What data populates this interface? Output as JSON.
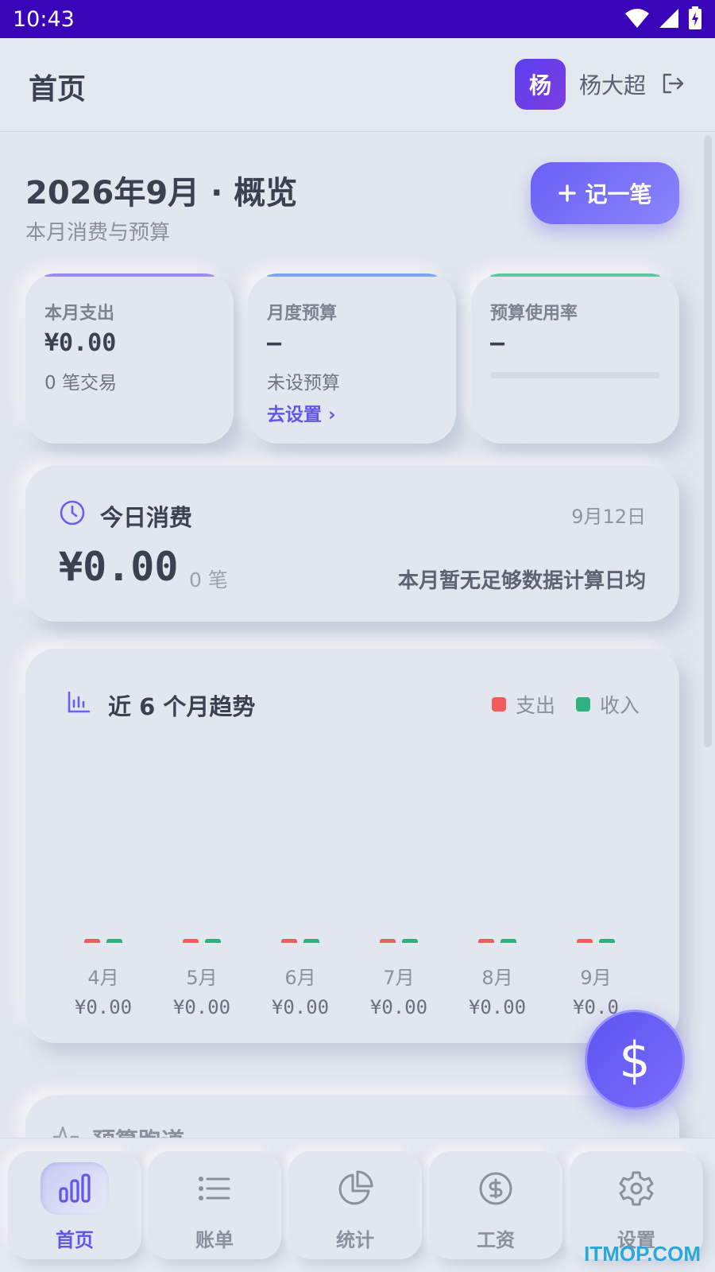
{
  "status_bar": {
    "time": "10:43"
  },
  "header": {
    "title": "首页",
    "avatar_text": "杨",
    "username": "杨大超"
  },
  "overview": {
    "title": "2026年9月 · 概览",
    "subtitle": "本月消费与预算",
    "add_button": "记一笔"
  },
  "stats": [
    {
      "label": "本月支出",
      "value": "¥0.00",
      "note": "0 笔交易",
      "accent": "#9b8cf0"
    },
    {
      "label": "月度预算",
      "value": "–",
      "note": "未设预算",
      "link": "去设置 ›",
      "accent": "#7aa6f0"
    },
    {
      "label": "预算使用率",
      "value": "–",
      "accent": "#5ccaa0",
      "progress": 0
    }
  ],
  "today": {
    "title": "今日消费",
    "date": "9月12日",
    "amount": "¥0.00",
    "count": "0 笔",
    "avg_note": "本月暂无足够数据计算日均"
  },
  "trend": {
    "title": "近 6 个月趋势",
    "legend": [
      {
        "name": "支出",
        "color": "#f25c5c"
      },
      {
        "name": "收入",
        "color": "#2fb07f"
      }
    ]
  },
  "chart_data": {
    "type": "bar",
    "categories": [
      "4月",
      "5月",
      "6月",
      "7月",
      "8月",
      "9月"
    ],
    "series": [
      {
        "name": "支出",
        "values": [
          0,
          0,
          0,
          0,
          0,
          0
        ]
      },
      {
        "name": "收入",
        "values": [
          0,
          0,
          0,
          0,
          0,
          0
        ]
      }
    ],
    "value_labels": [
      "¥0.00",
      "¥0.00",
      "¥0.00",
      "¥0.00",
      "¥0.00",
      "¥0.0"
    ],
    "title": "近 6 个月趋势"
  },
  "runway": {
    "title": "预算跑道"
  },
  "fab": {
    "symbol": "$"
  },
  "nav": [
    {
      "label": "首页",
      "icon": "bar-chart-icon",
      "active": true
    },
    {
      "label": "账单",
      "icon": "list-icon",
      "active": false
    },
    {
      "label": "统计",
      "icon": "pie-chart-icon",
      "active": false
    },
    {
      "label": "工资",
      "icon": "dollar-circle-icon",
      "active": false
    },
    {
      "label": "设置",
      "icon": "gear-icon",
      "active": false
    }
  ],
  "watermark": "ITMOP.COM",
  "colors": {
    "primary": "#6257e6",
    "status_bar": "#3a04b8",
    "expense": "#f25c5c",
    "income": "#2fb07f"
  }
}
